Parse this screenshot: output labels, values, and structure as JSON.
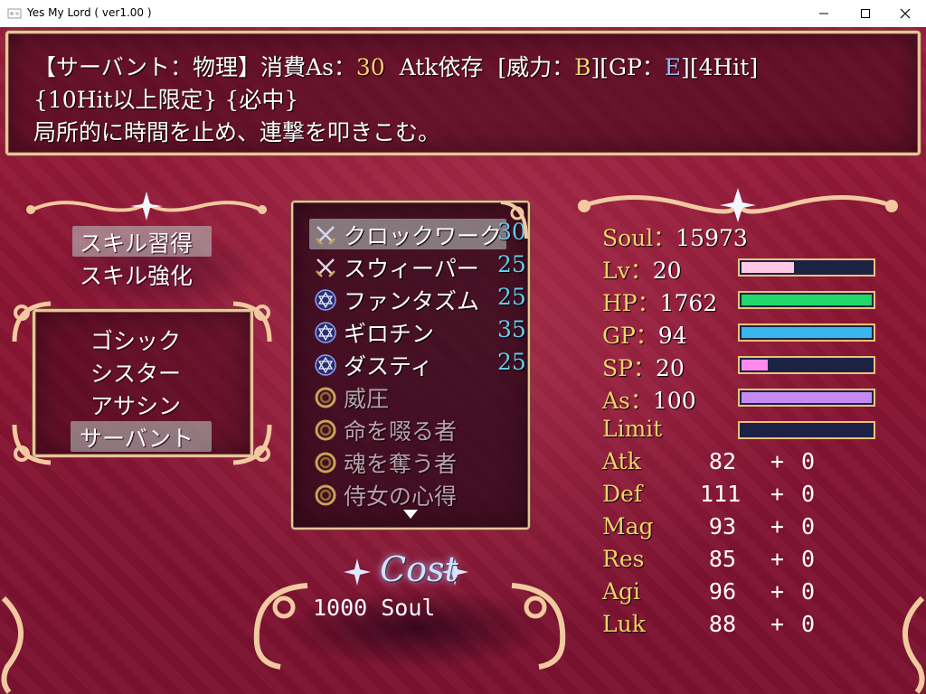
{
  "window": {
    "title": "Yes My Lord ( ver1.00 )",
    "icons": [
      "app-icon",
      "minimize-icon",
      "maximize-icon",
      "close-icon"
    ]
  },
  "help": {
    "line1": {
      "skill_type": "【サーバント：物理】",
      "consume_label": "消費As：",
      "consume_value": "30",
      "depend": "Atk依存",
      "power_open": "[威力：",
      "power_value": "B",
      "power_close": "]",
      "gp_open": "[GP：",
      "gp_value": "E",
      "gp_close": "]",
      "hits": "[4Hit]"
    },
    "line2": "{10Hit以上限定} {必中}",
    "line3": "局所的に時間を止め、連撃を叩きこむ。"
  },
  "mode_menu": {
    "items": [
      {
        "label": "スキル習得",
        "selected": true
      },
      {
        "label": "スキル強化",
        "selected": false
      }
    ]
  },
  "class_menu": {
    "items": [
      {
        "label": "ゴシック",
        "selected": false
      },
      {
        "label": "シスター",
        "selected": false
      },
      {
        "label": "アサシン",
        "selected": false
      },
      {
        "label": "サーバント",
        "selected": true
      }
    ]
  },
  "skills": [
    {
      "icon": "crossed-swords-icon",
      "name": "クロックワーク",
      "cost": "30",
      "selected": true,
      "dim": false
    },
    {
      "icon": "crossed-swords-icon",
      "name": "スウィーパー",
      "cost": "25",
      "selected": false,
      "dim": false
    },
    {
      "icon": "hexagram-icon",
      "name": "ファンタズム",
      "cost": "25",
      "selected": false,
      "dim": false
    },
    {
      "icon": "hexagram-icon",
      "name": "ギロチン",
      "cost": "35",
      "selected": false,
      "dim": false
    },
    {
      "icon": "hexagram-icon",
      "name": "ダスティ",
      "cost": "25",
      "selected": false,
      "dim": false
    },
    {
      "icon": "passive-ring-icon",
      "name": "威圧",
      "cost": "",
      "selected": false,
      "dim": true
    },
    {
      "icon": "passive-ring-icon",
      "name": "命を啜る者",
      "cost": "",
      "selected": false,
      "dim": true
    },
    {
      "icon": "passive-ring-icon",
      "name": "魂を奪う者",
      "cost": "",
      "selected": false,
      "dim": true
    },
    {
      "icon": "passive-ring-icon",
      "name": "侍女の心得",
      "cost": "",
      "selected": false,
      "dim": true
    }
  ],
  "cost": {
    "title": "Cost",
    "value": "1000 Soul"
  },
  "status": {
    "soul_label": "Soul：",
    "soul_value": "15973",
    "gauges": [
      {
        "label": "Lv：",
        "value": "20",
        "fill_pct": 40,
        "color": "#ffc8e6"
      },
      {
        "label": "HP：",
        "value": "1762",
        "fill_pct": 100,
        "color": "#22d86a"
      },
      {
        "label": "GP：",
        "value": "94",
        "fill_pct": 100,
        "color": "#3ab6ee"
      },
      {
        "label": "SP：",
        "value": "20",
        "fill_pct": 20,
        "color": "#ff8af0"
      },
      {
        "label": "As：",
        "value": "100",
        "fill_pct": 100,
        "color": "#c58af2"
      },
      {
        "label": "Limit",
        "value": "",
        "fill_pct": 0,
        "color": "#ffcc66"
      }
    ],
    "params": [
      {
        "name": "Atk",
        "base": "82",
        "plus": "+",
        "bonus": "0"
      },
      {
        "name": "Def",
        "base": "111",
        "plus": "+",
        "bonus": "0"
      },
      {
        "name": "Mag",
        "base": "93",
        "plus": "+",
        "bonus": "0"
      },
      {
        "name": "Res",
        "base": "85",
        "plus": "+",
        "bonus": "0"
      },
      {
        "name": "Agi",
        "base": "96",
        "plus": "+",
        "bonus": "0"
      },
      {
        "name": "Luk",
        "base": "88",
        "plus": "+",
        "bonus": "0"
      }
    ]
  },
  "colors": {
    "gold_text": "#f3d36b",
    "cost_number": "#66ccee",
    "frame_gold": "#e9c39a",
    "background": "#8a1633"
  }
}
